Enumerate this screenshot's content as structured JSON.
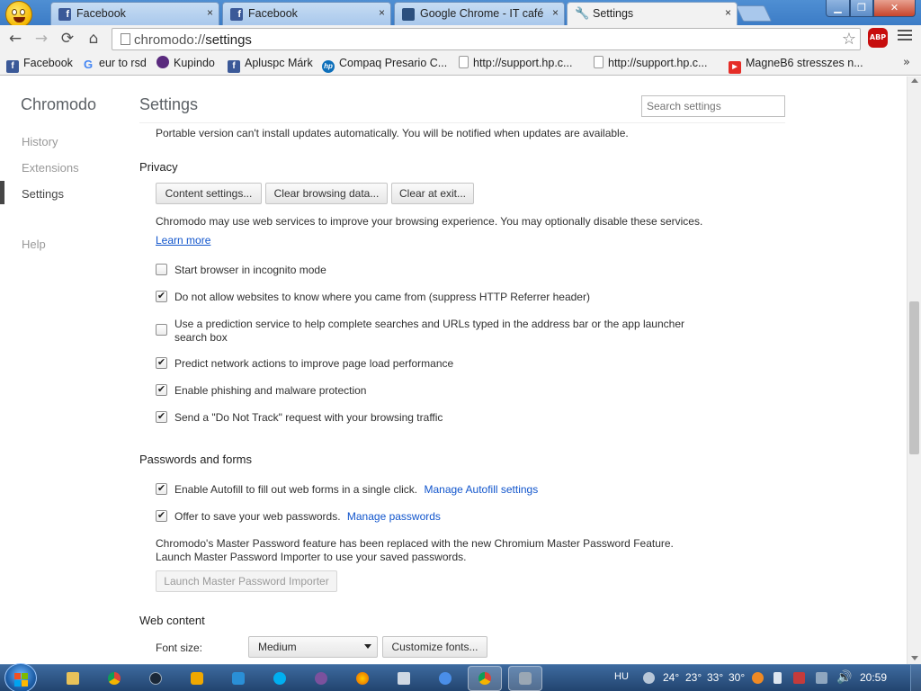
{
  "browser": {
    "tabs": [
      {
        "label": "Facebook",
        "icon": "facebook-icon",
        "close": "×"
      },
      {
        "label": "Facebook",
        "icon": "facebook-icon",
        "close": "×"
      },
      {
        "label": "Google Chrome - IT café",
        "icon": "it-cafe-icon",
        "close": "×"
      },
      {
        "label": "Settings",
        "icon": "wrench-icon",
        "close": "×"
      }
    ],
    "window_controls": {
      "minimize": "▁",
      "maximize": "❐",
      "close": "✕"
    },
    "url_scheme": "chromodo://",
    "url_path": "settings",
    "abp_label": "ABP",
    "bookmarks": [
      {
        "label": "Facebook",
        "icon": "facebook-icon"
      },
      {
        "label": "eur to rsd",
        "icon": "google-icon"
      },
      {
        "label": "Kupindo",
        "icon": "kupindo-icon"
      },
      {
        "label": "Apluspc Márk",
        "icon": "facebook-icon"
      },
      {
        "label": "Compaq Presario C...",
        "icon": "hp-icon"
      },
      {
        "label": "http://support.hp.c...",
        "icon": "page-icon"
      },
      {
        "label": "http://support.hp.c...",
        "icon": "page-icon"
      },
      {
        "label": "MagneB6 stresszes n...",
        "icon": "youtube-icon"
      }
    ],
    "bookmarks_overflow": "»"
  },
  "sidebar": {
    "brand": "Chromodo",
    "items": [
      {
        "label": "History"
      },
      {
        "label": "Extensions"
      },
      {
        "label": "Settings"
      },
      {
        "label": "Help"
      }
    ],
    "selected": "Settings"
  },
  "settings": {
    "title": "Settings",
    "search_placeholder": "Search settings",
    "update_notice": "Portable version can't install updates automatically. You will be notified when updates are available.",
    "privacy": {
      "heading": "Privacy",
      "buttons": [
        "Content settings...",
        "Clear browsing data...",
        "Clear at exit..."
      ],
      "description": "Chromodo may use web services to improve your browsing experience. You may optionally disable these services.",
      "learn_more": "Learn more",
      "options": [
        {
          "label": "Start browser in incognito mode",
          "checked": false
        },
        {
          "label": "Do not allow websites to know where you came from (suppress HTTP Referrer header)",
          "checked": true
        },
        {
          "label": "Use a prediction service to help complete searches and URLs typed in the address bar or the app launcher",
          "label2": "search box",
          "checked": false
        },
        {
          "label": "Predict network actions to improve page load performance",
          "checked": true
        },
        {
          "label": "Enable phishing and malware protection",
          "checked": true
        },
        {
          "label": "Send a \"Do Not Track\" request with your browsing traffic",
          "checked": true
        }
      ]
    },
    "passwords": {
      "heading": "Passwords and forms",
      "autofill_label": "Enable Autofill to fill out web forms in a single click.",
      "autofill_link": "Manage Autofill settings",
      "autofill_checked": true,
      "save_label": "Offer to save your web passwords.",
      "save_link": "Manage passwords",
      "save_checked": true,
      "master_notice_1": "Chromodo's Master Password feature has been replaced with the new Chromium Master Password Feature.",
      "master_notice_2": "Launch Master Password Importer to use your saved passwords.",
      "importer_button": "Launch Master Password Importer"
    },
    "web_content": {
      "heading": "Web content",
      "font_size_label": "Font size:",
      "font_size_value": "Medium",
      "customize_fonts": "Customize fonts..."
    }
  },
  "taskbar": {
    "language": "HU",
    "temps": [
      "24°",
      "23°",
      "33°",
      "30°"
    ],
    "clock": "20:59"
  }
}
